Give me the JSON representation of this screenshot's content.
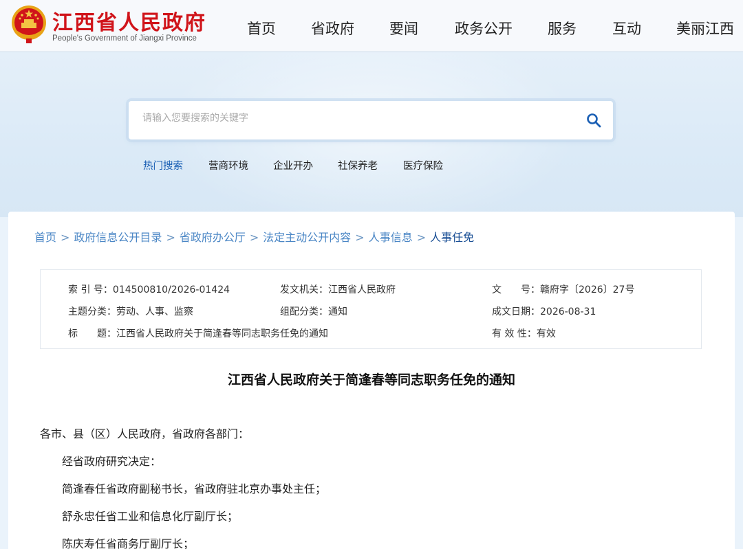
{
  "header": {
    "logo_cn": "江西省人民政府",
    "logo_en": "People's Government of Jiangxi Province",
    "nav": [
      "首页",
      "省政府",
      "要闻",
      "政务公开",
      "服务",
      "互动",
      "美丽江西"
    ]
  },
  "search": {
    "placeholder": "请输入您要搜索的关键字",
    "hot_label": "热门搜索",
    "hot_items": [
      "营商环境",
      "企业开办",
      "社保养老",
      "医疗保险"
    ]
  },
  "breadcrumb": [
    "首页",
    "政府信息公开目录",
    "省政府办公厅",
    "法定主动公开内容",
    "人事信息",
    "人事任免"
  ],
  "meta": {
    "index_key": "索 引 号：",
    "index_val": "014500810/2026-01424",
    "issuer_key": "发文机关：",
    "issuer_val": "江西省人民政府",
    "docno_key": "文　　号：",
    "docno_val": "赣府字〔2026〕27号",
    "topic_key": "主题分类：",
    "topic_val": "劳动、人事、监察",
    "category_key": "组配分类：",
    "category_val": "通知",
    "date_key": "成文日期：",
    "date_val": "2026-08-31",
    "title_key": "标　　题：",
    "title_val": "江西省人民政府关于简逢春等同志职务任免的通知",
    "valid_key": "有 效 性：",
    "valid_val": "有效"
  },
  "document": {
    "title": "江西省人民政府关于简逢春等同志职务任免的通知",
    "paragraphs": [
      "各市、县（区）人民政府，省政府各部门：",
      "经省政府研究决定：",
      "简逢春任省政府副秘书长，省政府驻北京办事处主任；",
      "舒永忠任省工业和信息化厅副厅长；",
      "陈庆寿任省商务厅副厅长；"
    ]
  },
  "colors": {
    "brand_red": "#d0141a",
    "link_blue": "#4a86c5",
    "active_blue": "#1a5fb4"
  },
  "icons": {
    "emblem": "national-emblem-icon",
    "search": "search-icon"
  }
}
